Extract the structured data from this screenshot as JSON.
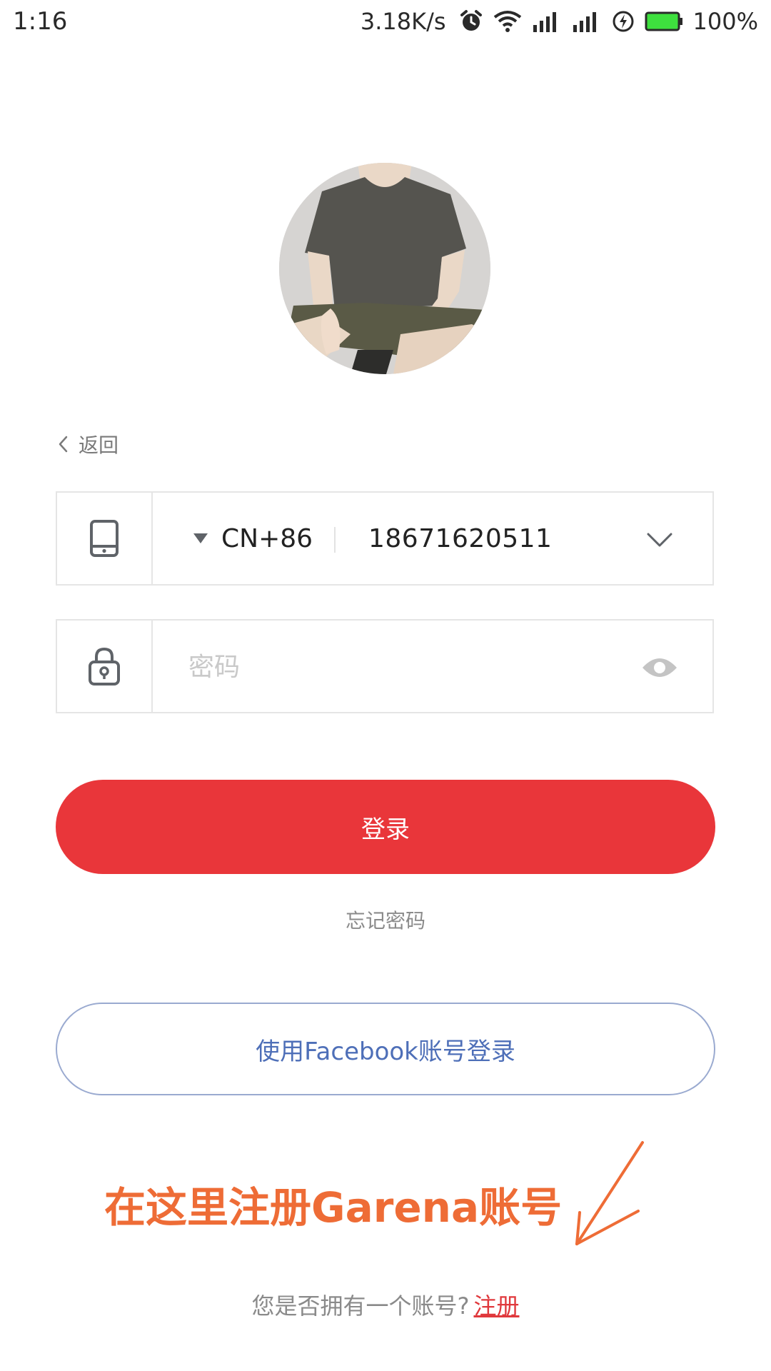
{
  "status_bar": {
    "time": "1:16",
    "network_speed": "3.18K/s",
    "battery_percent": "100%",
    "icons": [
      "alarm-icon",
      "wifi-icon",
      "signal-icon",
      "signal-icon",
      "charging-icon",
      "battery-icon"
    ],
    "battery_color": "#3ee03e"
  },
  "avatar": {
    "icon": "user-avatar"
  },
  "back": {
    "label": "返回"
  },
  "phone_field": {
    "country_code": "CN+86",
    "value": "18671620511"
  },
  "password_field": {
    "placeholder": "密码"
  },
  "login_button": {
    "label": "登录",
    "color": "#e9363a"
  },
  "forgot_password": {
    "label": "忘记密码"
  },
  "facebook_button": {
    "label": "使用Facebook账号登录",
    "color": "#4e6fb8"
  },
  "annotation": {
    "text": "在这里注册Garena账号",
    "color": "#ee6c36"
  },
  "register": {
    "prompt": "您是否拥有一个账号?",
    "link_label": "注册",
    "link_color": "#e0383c"
  }
}
